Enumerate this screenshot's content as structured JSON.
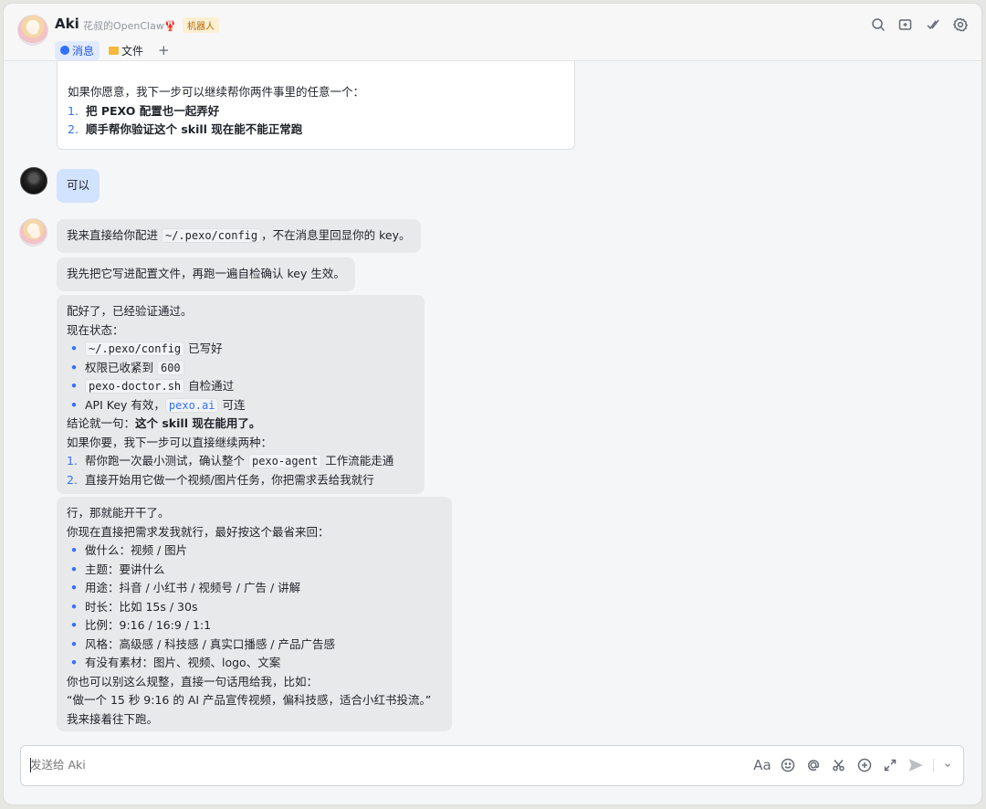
{
  "header": {
    "name": "Aki",
    "subtitle": "花叔的OpenClaw🦞",
    "badge": "机器人",
    "tabs": [
      {
        "label": "消息",
        "icon": "message-icon"
      },
      {
        "label": "文件",
        "icon": "folder-icon"
      },
      {
        "label": "+",
        "icon": "add-tab-icon"
      }
    ],
    "icons": [
      "search-icon",
      "add-chat-icon",
      "check-icon",
      "settings-icon"
    ]
  },
  "messages": {
    "m0": {
      "intro": "如果你愿意，我下一步可以继续帮你两件事里的任意一个：",
      "items": [
        {
          "num": "1.",
          "text": "把 PEXO 配置也一起弄好"
        },
        {
          "num": "2.",
          "text": "顺手帮你验证这个 skill 现在能不能正常跑"
        }
      ]
    },
    "m1": {
      "text": "可以"
    },
    "m2": {
      "pre": "我来直接给你配进 ",
      "code": "~/.pexo/config",
      "post": "，不在消息里回显你的 key。"
    },
    "m3": {
      "text": "我先把它写进配置文件，再跑一遍自检确认 key 生效。"
    },
    "m4": {
      "l1": "配好了，已经验证通过。",
      "l2": "现在状态：",
      "b1": {
        "code": "~/.pexo/config",
        "post": " 已写好"
      },
      "b2": {
        "pre": "权限已收紧到 ",
        "code": "600"
      },
      "b3": {
        "code": "pexo-doctor.sh",
        "post": " 自检通过"
      },
      "b4": {
        "pre": "API Key 有效，",
        "code": "pexo.ai",
        "post": " 可连"
      },
      "concl_pre": "结论就一句：",
      "concl_bold": "这个 skill 现在能用了。",
      "l3": "如果你要，我下一步可以直接继续两种：",
      "o1": {
        "num": "1.",
        "pre": "帮你跑一次最小测试，确认整个 ",
        "code": "pexo-agent",
        "post": " 工作流能走通"
      },
      "o2": {
        "num": "2.",
        "text": "直接开始用它做一个视频/图片任务，你把需求丢给我就行"
      }
    },
    "m5": {
      "l1": "行，那就能开干了。",
      "l2": "你现在直接把需求发我就行，最好按这个最省来回：",
      "bullets": [
        "做什么：视频 / 图片",
        "主题：要讲什么",
        "用途：抖音 / 小红书 / 视频号 / 广告 / 讲解",
        "时长：比如 15s / 30s",
        "比例：9:16 / 16:9 / 1:1",
        "风格：高级感 / 科技感 / 真实口播感 / 产品广告感",
        "有没有素材：图片、视频、logo、文案"
      ],
      "l3": "你也可以别这么规整，直接一句话甩给我，比如：",
      "l4": "“做一个 15 秒 9:16 的 AI 产品宣传视频，偏科技感，适合小红书投流。”",
      "l5": "我来接着往下跑。"
    }
  },
  "input": {
    "placeholder": "发送给 Aki"
  },
  "toolbar": {
    "font_label": "Aa",
    "icons": [
      "font-format-icon",
      "emoji-icon",
      "mention-icon",
      "scissors-icon",
      "add-icon",
      "expand-icon",
      "send-icon",
      "chevron-down-icon"
    ]
  }
}
